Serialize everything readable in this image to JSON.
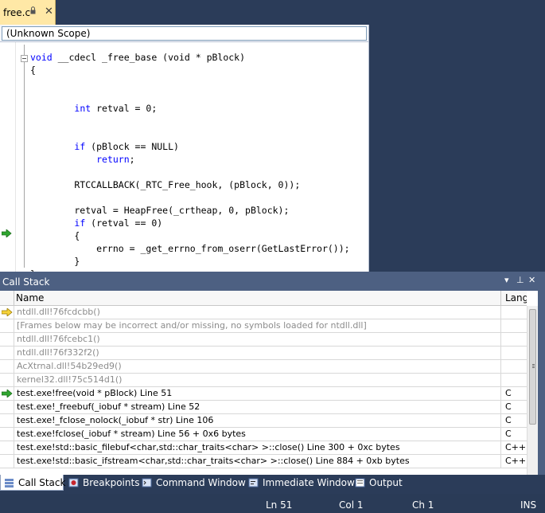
{
  "document_tab": {
    "title": "free.c",
    "close_glyph": "✕"
  },
  "scope_bar": {
    "value": "(Unknown Scope)"
  },
  "code_lines": [
    {
      "kw": "void",
      "text": " __cdecl _free_base (void * pBlock)"
    },
    {
      "kw": "",
      "text": "{"
    },
    {
      "kw": "",
      "text": ""
    },
    {
      "kw": "",
      "text": ""
    },
    {
      "kw": "",
      "text": "        ",
      "kw2": "int",
      "text2": " retval = 0;"
    },
    {
      "kw": "",
      "text": ""
    },
    {
      "kw": "",
      "text": ""
    },
    {
      "kw": "",
      "text": "        ",
      "kw2": "if",
      "text2": " (pBlock == NULL)"
    },
    {
      "kw": "",
      "text": "            ",
      "kw2": "return",
      "text2": ";"
    },
    {
      "kw": "",
      "text": ""
    },
    {
      "kw": "",
      "text": "        RTCCALLBACK(_RTC_Free_hook, (pBlock, 0));"
    },
    {
      "kw": "",
      "text": ""
    },
    {
      "kw": "",
      "text": "        retval = HeapFree(_crtheap, 0, pBlock);"
    },
    {
      "kw": "",
      "text": "        ",
      "kw2": "if",
      "text2": " (retval == 0)"
    },
    {
      "kw": "",
      "text": "        {"
    },
    {
      "kw": "",
      "text": "            errno = _get_errno_from_oserr(GetLastError());"
    },
    {
      "kw": "",
      "text": "        }"
    },
    {
      "kw": "",
      "text": "}"
    }
  ],
  "call_stack": {
    "title": "Call Stack",
    "buttons": {
      "dropdown": "▾",
      "pin": "⊥",
      "close": "✕"
    },
    "columns": {
      "name": "Name",
      "lang": "Lang"
    },
    "rows": [
      {
        "name": "ntdll.dll!76fcdcbb()",
        "lang": "",
        "grey": true,
        "marker": "yellow-arrow"
      },
      {
        "name": "[Frames below may be incorrect and/or missing, no symbols loaded for ntdll.dll]",
        "lang": "",
        "grey": true,
        "marker": ""
      },
      {
        "name": "ntdll.dll!76fcebc1()",
        "lang": "",
        "grey": true,
        "marker": ""
      },
      {
        "name": "ntdll.dll!76f332f2()",
        "lang": "",
        "grey": true,
        "marker": ""
      },
      {
        "name": "AcXtrnal.dll!54b29ed9()",
        "lang": "",
        "grey": true,
        "marker": ""
      },
      {
        "name": "kernel32.dll!75c514d1()",
        "lang": "",
        "grey": true,
        "marker": ""
      },
      {
        "name": "test.exe!free(void * pBlock)  Line 51",
        "lang": "C",
        "grey": false,
        "marker": "green-arrow"
      },
      {
        "name": "test.exe!_freebuf(_iobuf * stream)  Line 52",
        "lang": "C",
        "grey": false,
        "marker": ""
      },
      {
        "name": "test.exe!_fclose_nolock(_iobuf * str)  Line 106",
        "lang": "C",
        "grey": false,
        "marker": ""
      },
      {
        "name": "test.exe!fclose(_iobuf * stream)  Line 56 + 0x6 bytes",
        "lang": "C",
        "grey": false,
        "marker": ""
      },
      {
        "name": "test.exe!std::basic_filebuf<char,std::char_traits<char> >::close()  Line 300 + 0xc bytes",
        "lang": "C++",
        "grey": false,
        "marker": ""
      },
      {
        "name": "test.exe!std::basic_ifstream<char,std::char_traits<char> >::close()  Line 884 + 0xb bytes",
        "lang": "C++",
        "grey": false,
        "marker": ""
      }
    ]
  },
  "tool_tabs": [
    {
      "label": "Call Stack",
      "icon": "call-stack-icon",
      "active": true
    },
    {
      "label": "Breakpoints",
      "icon": "breakpoints-icon",
      "active": false
    },
    {
      "label": "Command Window",
      "icon": "command-window-icon",
      "active": false
    },
    {
      "label": "Immediate Window",
      "icon": "immediate-window-icon",
      "active": false
    },
    {
      "label": "Output",
      "icon": "output-icon",
      "active": false
    }
  ],
  "status_bar": {
    "line": "Ln 51",
    "col": "Col 1",
    "ch": "Ch 1",
    "mode": "INS"
  },
  "colors": {
    "chrome_dark": "#2b3c59",
    "panel_title": "#4d6082",
    "tab_active": "#ffe8a6",
    "keyword": "#0000ff",
    "grey_frame": "#8c8c8c"
  }
}
